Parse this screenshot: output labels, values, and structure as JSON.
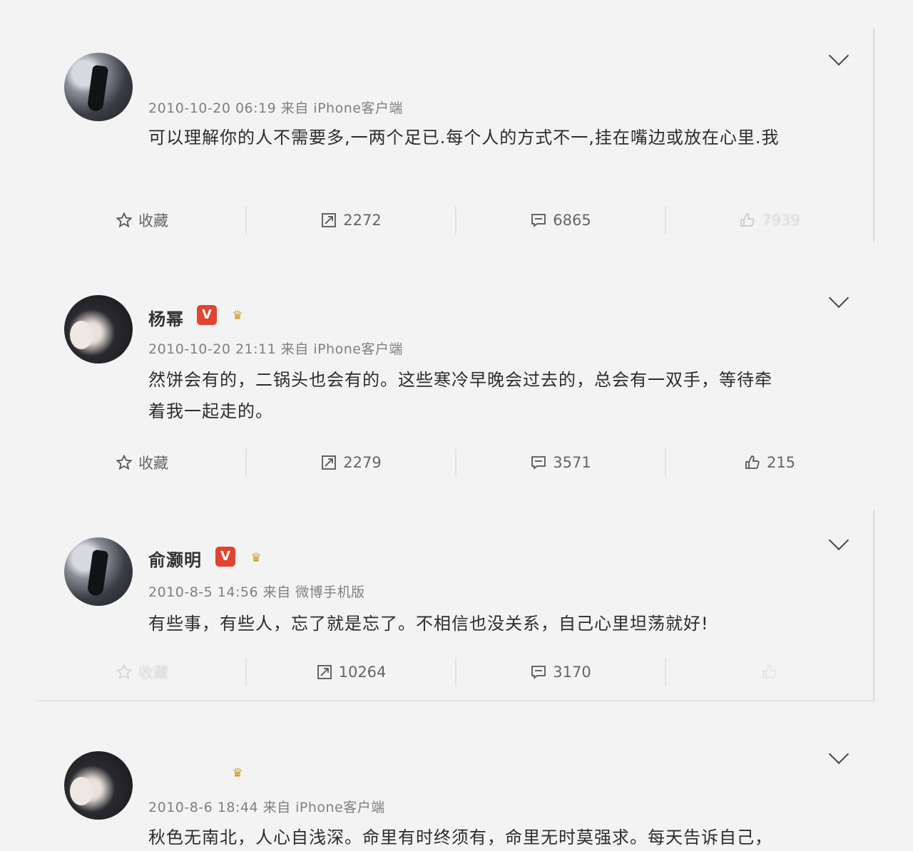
{
  "posts": [
    {
      "name": "",
      "time_source": "2010-10-20 06:19 来自 iPhone客户端",
      "text": "可以理解你的人不需要多,一两个足已.每个人的方式不一,挂在嘴边或放在心里.我",
      "actions": {
        "favorite": "收藏",
        "repost": "2272",
        "comment": "6865",
        "like": "7939"
      }
    },
    {
      "name": "杨幂",
      "badge_v": "V",
      "time_source": "2010-10-20 21:11 来自 iPhone客户端",
      "text_line1": "然饼会有的，二锅头也会有的。这些寒冷早晚会过去的，总会有一双手，等待牵",
      "text_line2": "着我一起走的。",
      "actions": {
        "favorite": "收藏",
        "repost": "2279",
        "comment": "3571",
        "like": "215"
      }
    },
    {
      "name": "俞灏明",
      "badge_v": "V",
      "time_source": "2010-8-5 14:56 来自 微博手机版",
      "text": "有些事，有些人，忘了就是忘了。不相信也没关系，自己心里坦荡就好!",
      "actions": {
        "favorite": "收藏",
        "repost": "10264",
        "comment": "3170"
      }
    },
    {
      "name": "",
      "time_source": "2010-8-6 18:44 来自 iPhone客户端",
      "text": "秋色无南北，人心自浅深。命里有时终须有，命里无时莫强求。每天告诉自己，"
    }
  ],
  "icons": {
    "favorite": "star-icon",
    "repost": "repost-icon",
    "comment": "comment-icon",
    "like": "thumbs-up-icon",
    "more": "chevron-down-icon"
  },
  "colors": {
    "v_badge": "#e2452f",
    "crown": "#c99a1e",
    "meta": "#808080",
    "text": "#2c2c2c"
  }
}
